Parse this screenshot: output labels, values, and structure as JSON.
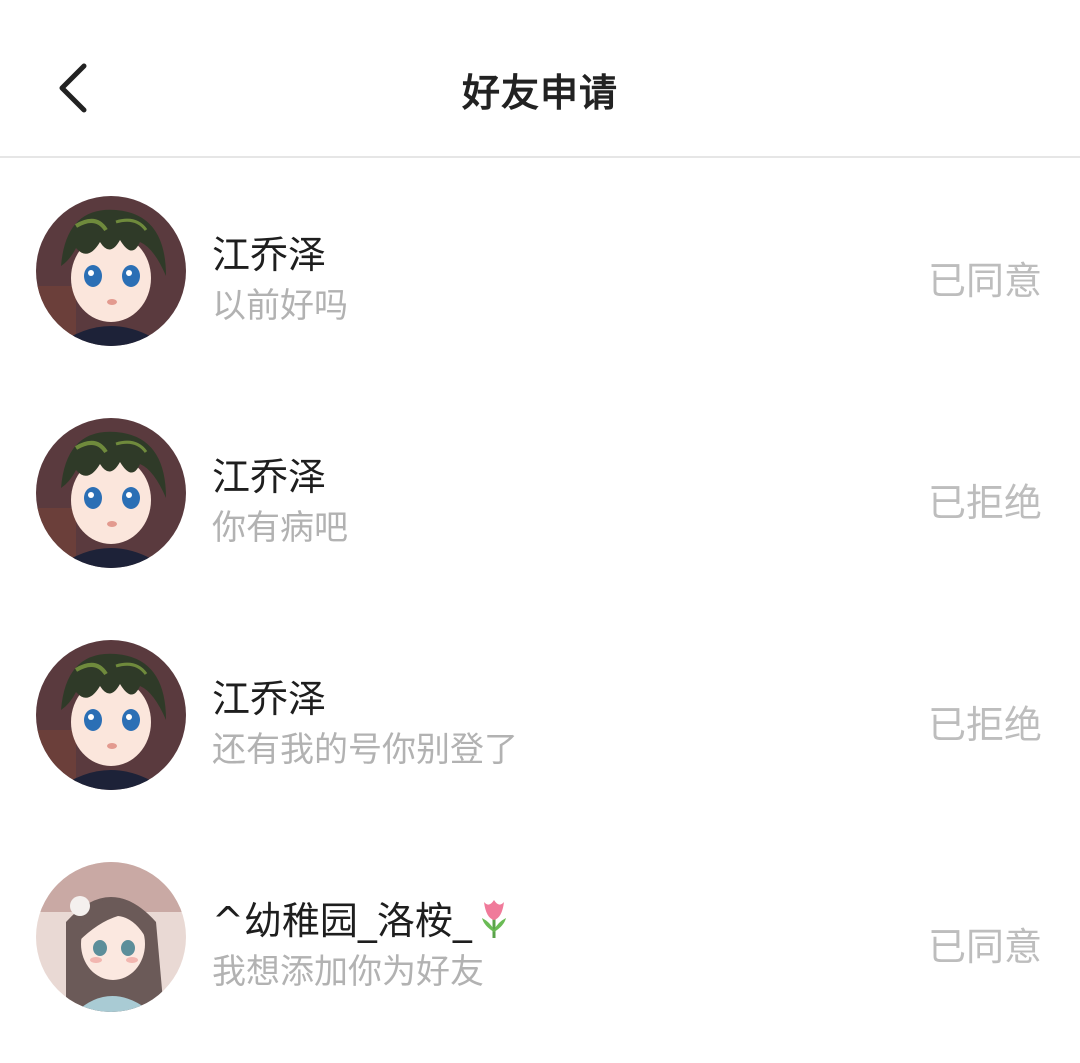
{
  "header": {
    "title": "好友申请"
  },
  "requests": [
    {
      "name": "江乔泽",
      "message": "以前好吗",
      "status": "已同意",
      "avatar": "anime-boy-avatar"
    },
    {
      "name": "江乔泽",
      "message": "你有病吧",
      "status": "已拒绝",
      "avatar": "anime-boy-avatar"
    },
    {
      "name": "江乔泽",
      "message": "还有我的号你别登了",
      "status": "已拒绝",
      "avatar": "anime-boy-avatar"
    },
    {
      "name": "^幼稚园_洛桉_",
      "message": "我想添加你为好友",
      "status": "已同意",
      "avatar": "anime-girl-avatar",
      "name_icon": "tulip-icon"
    }
  ],
  "colors": {
    "name": "#1e1e1e",
    "message": "#b2b2b2",
    "status": "#bdbdbd",
    "divider": "#e6e6e6"
  }
}
